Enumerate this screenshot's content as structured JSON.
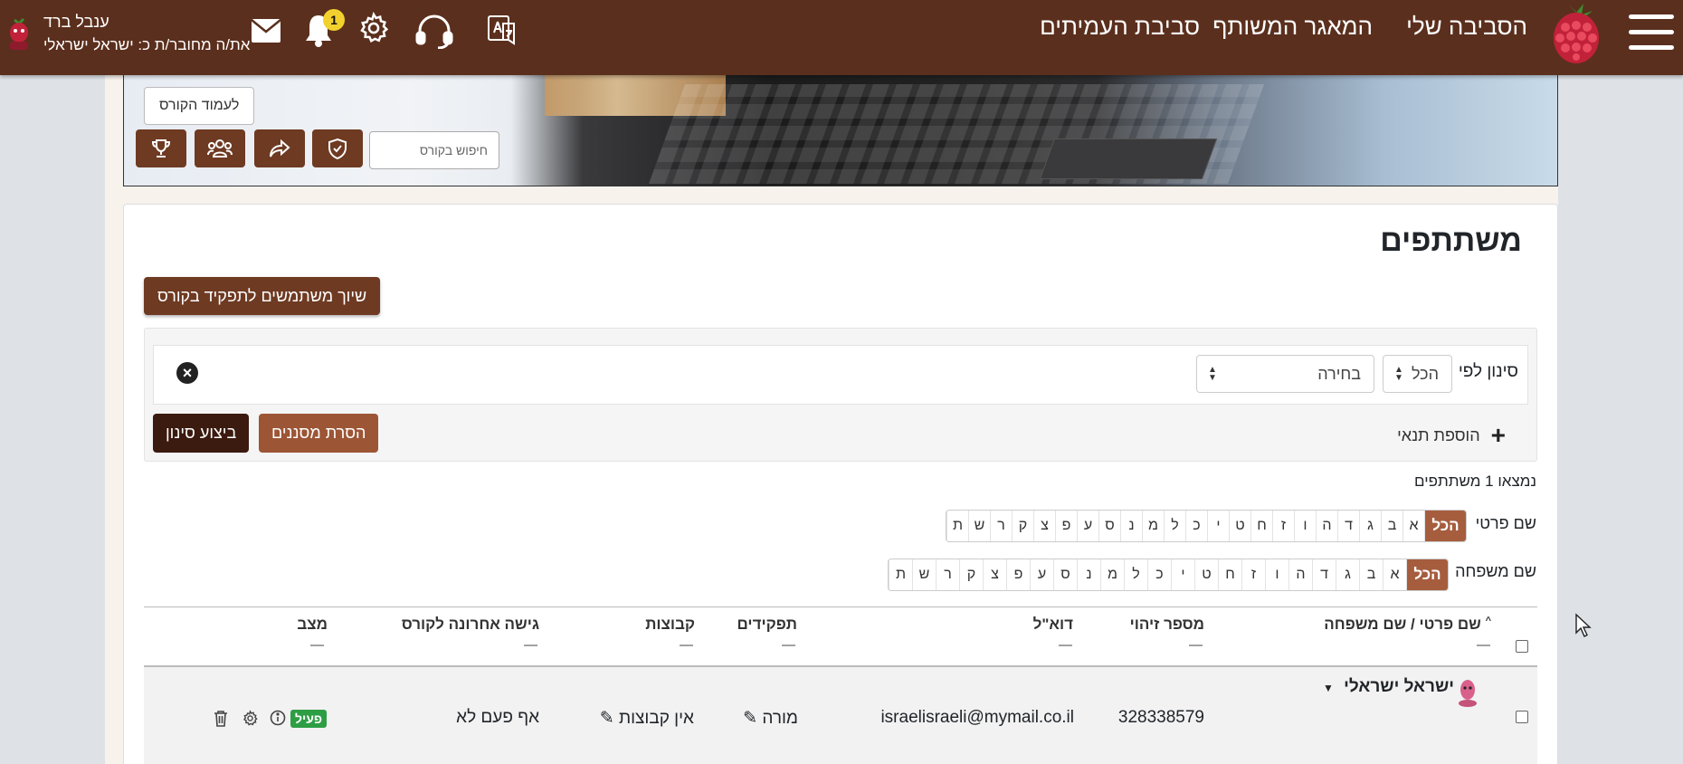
{
  "navbar": {
    "links": [
      "הסביבה שלי",
      "המאגר המשותף",
      "סביבת העמיתים"
    ],
    "notification_count": "1",
    "user": {
      "name": "ענבל ברד",
      "logged_in_as": "את/ה מחובר/ת כ: ישראל ישראלי"
    },
    "colors": {
      "bar": "#5b2f1d",
      "badge": "#f2d12e"
    }
  },
  "course_header": {
    "course_page_button": "לעמוד הקורס",
    "search_placeholder": "חיפוש בקורס",
    "tool_buttons": [
      "shield-icon",
      "share-icon",
      "group-icon",
      "trophy-icon"
    ]
  },
  "participants": {
    "title": "משתתפים",
    "enrol_button": "שיוך משתמשים לתפקיד בקורס",
    "filter": {
      "label": "סינון לפי",
      "match_select": "הכל",
      "criteria_select": "בחירה",
      "add_condition": "הוספת תנאי",
      "clear_filters": "הסרת מסננים",
      "apply_filters": "ביצוע סינון"
    },
    "found_text": "נמצאו 1 משתתפים",
    "firstname_label": "שם פרטי",
    "lastname_label": "שם משפחה",
    "all_letter": "הכל",
    "letters": [
      "א",
      "ב",
      "ג",
      "ד",
      "ה",
      "ו",
      "ז",
      "ח",
      "ט",
      "י",
      "כ",
      "ל",
      "מ",
      "נ",
      "ס",
      "ע",
      "פ",
      "צ",
      "ק",
      "ר",
      "ש",
      "ת"
    ],
    "columns": {
      "name": "שם פרטי / שם משפחה",
      "idnumber": "מספר זיהוי",
      "email": "דוא\"ל",
      "roles": "תפקידים",
      "groups": "קבוצות",
      "lastaccess": "גישה אחרונה לקורס",
      "status": "מצב",
      "dash": "—"
    },
    "rows": [
      {
        "name": "ישראל ישראלי",
        "idnumber": "328338579",
        "email": "israelisraeli@mymail.co.il",
        "role": "מורה",
        "groups": "אין קבוצות",
        "lastaccess": "אף פעם לא",
        "status": "פעיל"
      }
    ]
  }
}
